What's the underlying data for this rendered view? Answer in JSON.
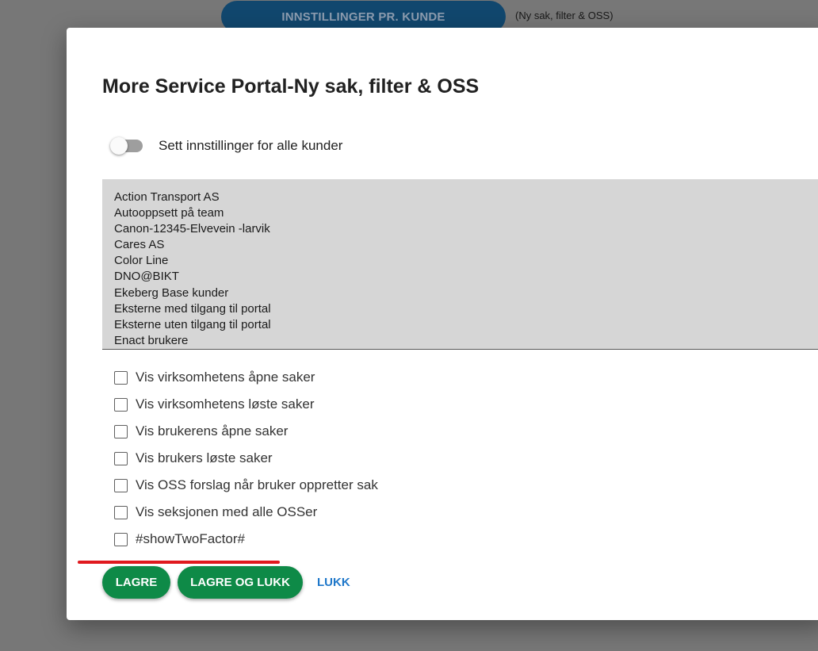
{
  "background": {
    "button_label": "INNSTILLINGER PR. KUNDE",
    "note": "(Ny sak, filter & OSS)"
  },
  "dialog": {
    "title": "More Service Portal-Ny sak, filter & OSS",
    "toggle": {
      "label": "Sett innstillinger for alle kunder",
      "checked": false
    },
    "customers": [
      "Action Transport AS",
      "Autooppsett på team",
      "Canon-12345-Elvevein -larvik",
      "Cares AS",
      "Color Line",
      "DNO@BIKT",
      "Ekeberg Base kunder",
      "Eksterne med tilgang til portal",
      "Eksterne uten tilgang til portal",
      "Enact brukere"
    ],
    "options": [
      {
        "label": "Vis virksomhetens åpne saker",
        "checked": false
      },
      {
        "label": "Vis virksomhetens løste saker",
        "checked": false
      },
      {
        "label": "Vis brukerens åpne saker",
        "checked": false
      },
      {
        "label": "Vis brukers løste saker",
        "checked": false
      },
      {
        "label": "Vis OSS forslag når bruker oppretter sak",
        "checked": false
      },
      {
        "label": "Vis seksjonen med alle OSSer",
        "checked": false
      },
      {
        "label": "#showTwoFactor#",
        "checked": false
      }
    ],
    "buttons": {
      "save": "LAGRE",
      "save_close": "LAGRE OG LUKK",
      "close": "LUKK"
    }
  },
  "colors": {
    "primary_button": "#0e8a47",
    "link": "#1e77c9",
    "highlight_underline": "#e0191e",
    "header_button": "#11476e"
  }
}
